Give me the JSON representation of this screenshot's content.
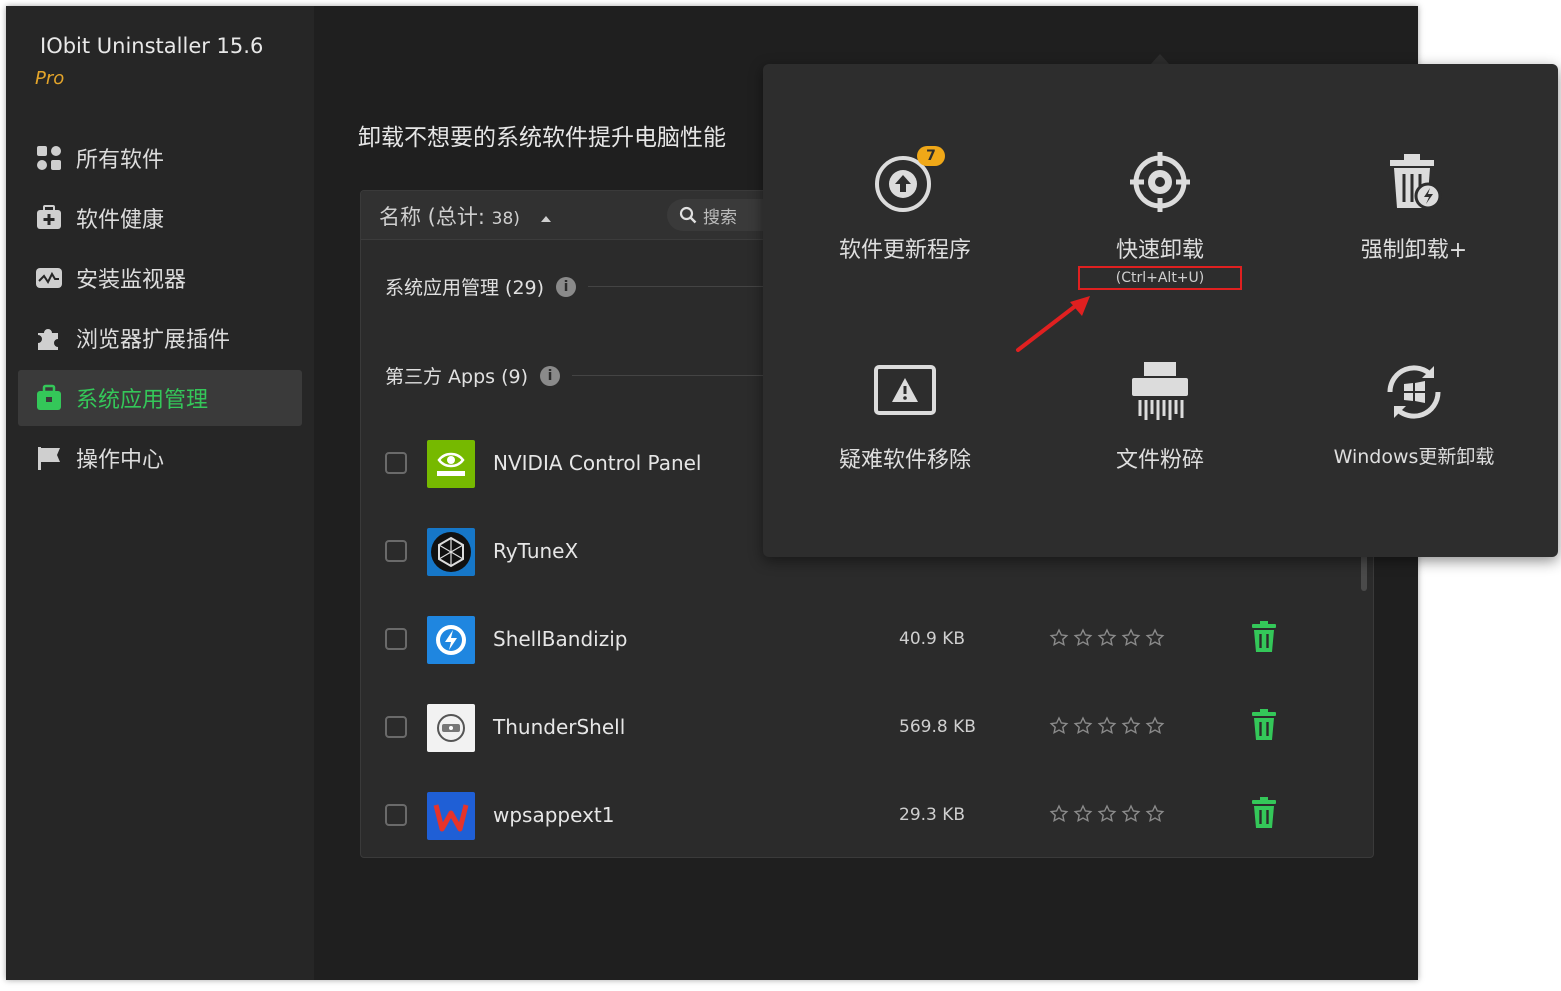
{
  "window": {
    "app_title": "IObit Uninstaller 15.6",
    "edition": "Pro"
  },
  "sidebar": {
    "items": [
      {
        "label": "所有软件",
        "icon": "grid-icon",
        "active": false
      },
      {
        "label": "软件健康",
        "icon": "medkit-icon",
        "active": false
      },
      {
        "label": "安装监视器",
        "icon": "monitor-icon",
        "active": false
      },
      {
        "label": "浏览器扩展插件",
        "icon": "puzzle-icon",
        "active": false
      },
      {
        "label": "系统应用管理",
        "icon": "briefcase-icon",
        "active": true
      },
      {
        "label": "操作中心",
        "icon": "flag-icon",
        "active": false
      }
    ]
  },
  "main": {
    "headline": "卸载不想要的系统软件提升电脑性能",
    "column_name": "名称 (总计: ",
    "column_count": "38)",
    "search_placeholder": "搜索",
    "groups": [
      {
        "label": "系统应用管理 (29)"
      },
      {
        "label": "第三方 Apps (9)"
      }
    ],
    "apps": [
      {
        "name": "NVIDIA Control Panel",
        "size": "",
        "rating": 0
      },
      {
        "name": "RyTuneX",
        "size": "",
        "rating": 0
      },
      {
        "name": "ShellBandizip",
        "size": "40.9 KB",
        "rating": 0
      },
      {
        "name": "ThunderShell",
        "size": "569.8 KB",
        "rating": 0
      },
      {
        "name": "wpsappext1",
        "size": "29.3 KB",
        "rating": 0
      }
    ]
  },
  "tools_popup": {
    "tools": [
      {
        "label": "软件更新程序",
        "icon": "update-arrow-icon",
        "badge": "7"
      },
      {
        "label": "快速卸载",
        "icon": "crosshair-icon",
        "hotkey": "(Ctrl+Alt+U)"
      },
      {
        "label": "强制卸载+",
        "icon": "force-trash-icon"
      },
      {
        "label": "疑难软件移除",
        "icon": "warning-box-icon"
      },
      {
        "label": "文件粉碎",
        "icon": "shredder-icon"
      },
      {
        "label": "Windows更新卸载",
        "icon": "windows-update-icon"
      }
    ]
  },
  "colors": {
    "accent_green": "#34c759",
    "pro_orange": "#e3a42a",
    "badge_orange": "#f0a818",
    "highlight_red": "#e02020"
  }
}
